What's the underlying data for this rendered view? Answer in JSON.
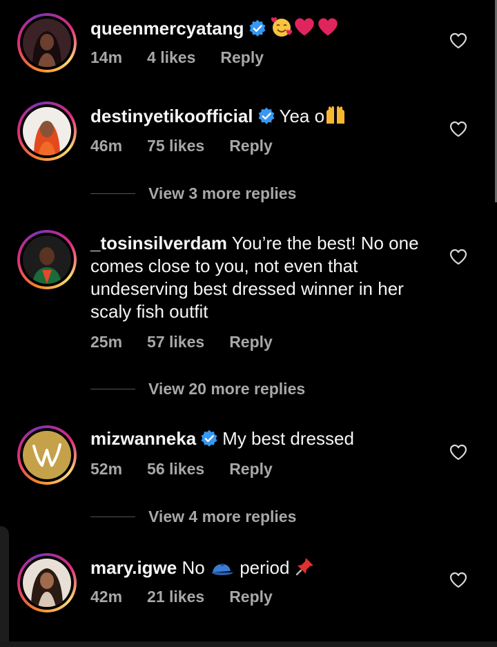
{
  "comments": [
    {
      "username": "queenmercyatang",
      "verified": true,
      "text": "",
      "time": "14m",
      "likes": "4 likes",
      "reply": "Reply"
    },
    {
      "username": "destinyetikoofficial",
      "verified": true,
      "text": "Yea o",
      "time": "46m",
      "likes": "75 likes",
      "reply": "Reply",
      "view_more": "View 3 more replies"
    },
    {
      "username": "_tosinsilverdam",
      "verified": false,
      "text": "You’re the best! No one comes close to you, not even that undeserving best dressed winner in her scaly fish outfit",
      "time": "25m",
      "likes": "57 likes",
      "reply": "Reply",
      "view_more": "View 20 more replies"
    },
    {
      "username": "mizwanneka",
      "verified": true,
      "text": "My best dressed",
      "time": "52m",
      "likes": "56 likes",
      "reply": "Reply",
      "view_more": "View 4 more replies"
    },
    {
      "username": "mary.igwe",
      "verified": false,
      "text": "No",
      "text_after": "period",
      "time": "42m",
      "likes": "21 likes",
      "reply": "Reply"
    }
  ],
  "icons": {
    "like": "heart-outline-icon",
    "verified": "verified-badge-icon"
  },
  "colors": {
    "background": "#000000",
    "text": "#f5f5f5",
    "muted": "#a8a8a8",
    "verified": "#3897f0",
    "emoji_heart": "#e0245e"
  }
}
